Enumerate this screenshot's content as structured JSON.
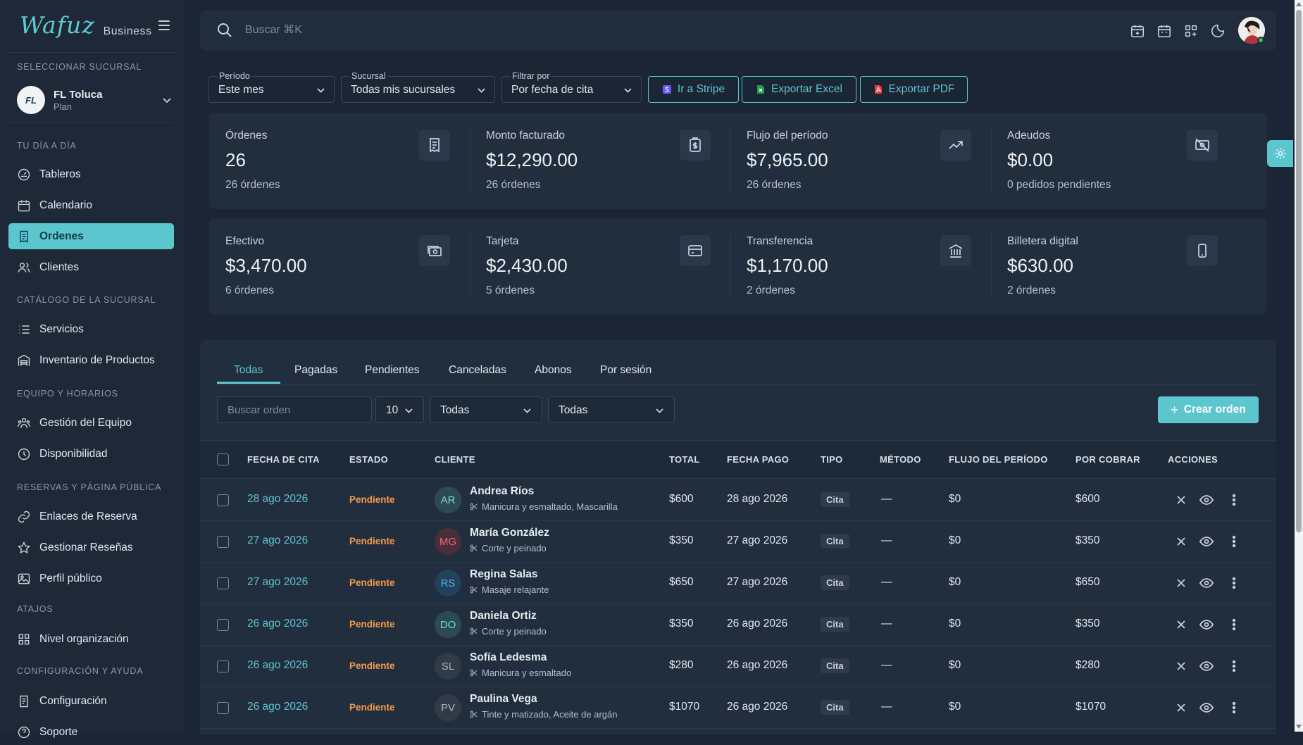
{
  "brand": {
    "logo": "Wafuz",
    "sub": "Business"
  },
  "sidebar": {
    "select_branch_label": "SELECCIONAR SUCURSAL",
    "branch": {
      "name": "FL Toluca",
      "plan": "Plan",
      "avatar_text": "FL"
    },
    "sections": [
      {
        "title": "TU DÍA A DÍA",
        "items": [
          {
            "label": "Tableros",
            "icon": "gauge-icon"
          },
          {
            "label": "Calendario",
            "icon": "calendar-icon"
          },
          {
            "label": "Ordenes",
            "icon": "receipt-icon",
            "active": true
          },
          {
            "label": "Clientes",
            "icon": "users-icon"
          }
        ]
      },
      {
        "title": "CATÁLOGO DE LA SUCURSAL",
        "items": [
          {
            "label": "Servicios",
            "icon": "list-icon"
          },
          {
            "label": "Inventario de Productos",
            "icon": "warehouse-icon"
          }
        ]
      },
      {
        "title": "EQUIPO Y HORARIOS",
        "items": [
          {
            "label": "Gestión del Equipo",
            "icon": "team-icon"
          },
          {
            "label": "Disponibilidad",
            "icon": "clock-icon"
          }
        ]
      },
      {
        "title": "RESERVAS Y PÁGINA PÚBLICA",
        "items": [
          {
            "label": "Enlaces de Reserva",
            "icon": "link-icon"
          },
          {
            "label": "Gestionar Reseñas",
            "icon": "star-icon"
          },
          {
            "label": "Perfil público",
            "icon": "image-icon"
          }
        ]
      },
      {
        "title": "ATAJOS",
        "items": [
          {
            "label": "Nivel organización",
            "icon": "grid-icon"
          }
        ]
      },
      {
        "title": "CONFIGURACIÓN Y AYUDA",
        "items": [
          {
            "label": "Configuración",
            "icon": "settings-list-icon"
          },
          {
            "label": "Soporte",
            "icon": "help-icon"
          }
        ]
      }
    ]
  },
  "topbar": {
    "search_placeholder": "Buscar ⌘K"
  },
  "filters": {
    "period": {
      "label": "Período",
      "value": "Este mes"
    },
    "branch": {
      "label": "Sucursal",
      "value": "Todas mis sucursales"
    },
    "filter_by": {
      "label": "Filtrar por",
      "value": "Por fecha de cita"
    },
    "stripe": "Ir a Stripe",
    "excel": "Exportar Excel",
    "pdf": "Exportar PDF"
  },
  "stats_row1": [
    {
      "label": "Órdenes",
      "value": "26",
      "sub": "26 órdenes",
      "icon": "receipt-icon"
    },
    {
      "label": "Monto facturado",
      "value": "$12,290.00",
      "sub": "26 órdenes",
      "icon": "clipboard-dollar-icon"
    },
    {
      "label": "Flujo del período",
      "value": "$7,965.00",
      "sub": "26 órdenes",
      "icon": "trending-up-icon"
    },
    {
      "label": "Adeudos",
      "value": "$0.00",
      "sub": "0 pedidos pendientes",
      "icon": "cash-off-icon"
    }
  ],
  "stats_row2": [
    {
      "label": "Efectivo",
      "value": "$3,470.00",
      "sub": "6 órdenes",
      "icon": "cash-icon"
    },
    {
      "label": "Tarjeta",
      "value": "$2,430.00",
      "sub": "5 órdenes",
      "icon": "credit-card-icon"
    },
    {
      "label": "Transferencia",
      "value": "$1,170.00",
      "sub": "2 órdenes",
      "icon": "bank-icon"
    },
    {
      "label": "Billetera digital",
      "value": "$630.00",
      "sub": "2 órdenes",
      "icon": "phone-icon"
    }
  ],
  "tabs": [
    "Todas",
    "Pagadas",
    "Pendientes",
    "Canceladas",
    "Abonos",
    "Por sesión"
  ],
  "controls": {
    "search_placeholder": "Buscar orden",
    "page_size": "10",
    "status_filter": "Todas",
    "type_filter": "Todas",
    "create": "Crear orden"
  },
  "table": {
    "headers": [
      "FECHA DE CITA",
      "ESTADO",
      "CLIENTE",
      "TOTAL",
      "FECHA PAGO",
      "TIPO",
      "MÉTODO",
      "FLUJO DEL PERÍODO",
      "POR COBRAR",
      "ACCIONES"
    ],
    "rows": [
      {
        "date": "28 ago 2026",
        "status": "Pendiente",
        "initials": "AR",
        "avatar_color": "#2b4a55",
        "initials_color": "#7fd0d8",
        "name": "Andrea Ríos",
        "services": "Manicura y esmaltado, Mascarilla",
        "total": "$600",
        "pay_date": "28 ago 2026",
        "type": "Cita",
        "method": "—",
        "flow": "$0",
        "due": "$600"
      },
      {
        "date": "27 ago 2026",
        "status": "Pendiente",
        "initials": "MG",
        "avatar_color": "#4a2e38",
        "initials_color": "#ef6b7d",
        "name": "María González",
        "services": "Corte y peinado",
        "total": "$350",
        "pay_date": "27 ago 2026",
        "type": "Cita",
        "method": "—",
        "flow": "$0",
        "due": "$350"
      },
      {
        "date": "27 ago 2026",
        "status": "Pendiente",
        "initials": "RS",
        "avatar_color": "#24415a",
        "initials_color": "#4fb3e6",
        "name": "Regina Salas",
        "services": "Masaje relajante",
        "total": "$650",
        "pay_date": "27 ago 2026",
        "type": "Cita",
        "method": "—",
        "flow": "$0",
        "due": "$650"
      },
      {
        "date": "26 ago 2026",
        "status": "Pendiente",
        "initials": "DO",
        "avatar_color": "#2b4a55",
        "initials_color": "#7fd0d8",
        "name": "Daniela Ortiz",
        "services": "Corte y peinado",
        "total": "$350",
        "pay_date": "26 ago 2026",
        "type": "Cita",
        "method": "—",
        "flow": "$0",
        "due": "$350"
      },
      {
        "date": "26 ago 2026",
        "status": "Pendiente",
        "initials": "SL",
        "avatar_color": "#313b48",
        "initials_color": "#a9b3c0",
        "name": "Sofía Ledesma",
        "services": "Manicura y esmaltado",
        "total": "$280",
        "pay_date": "26 ago 2026",
        "type": "Cita",
        "method": "—",
        "flow": "$0",
        "due": "$280"
      },
      {
        "date": "26 ago 2026",
        "status": "Pendiente",
        "initials": "PV",
        "avatar_color": "#313b48",
        "initials_color": "#a9b3c0",
        "name": "Paulina Vega",
        "services": "Tinte y matizado, Aceite de argán",
        "total": "$1070",
        "pay_date": "26 ago 2026",
        "type": "Cita",
        "method": "—",
        "flow": "$0",
        "due": "$1070"
      }
    ]
  },
  "colors": {
    "accent": "#5cc6ce",
    "pending": "#f39c4a",
    "bg": "#1b2533",
    "card": "#222e3d"
  }
}
